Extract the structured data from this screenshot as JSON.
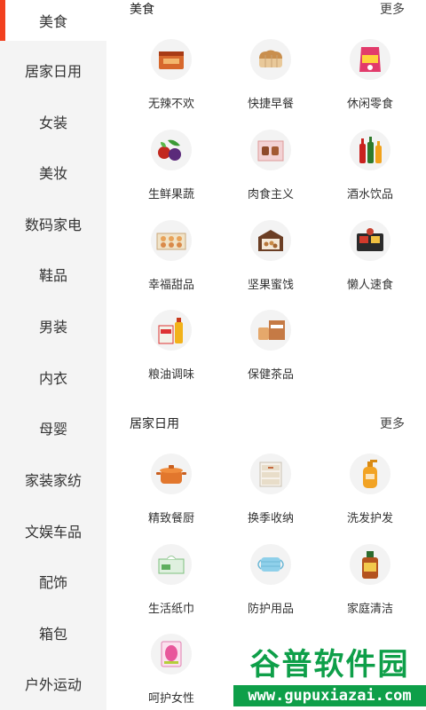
{
  "sidebar": {
    "items": [
      {
        "label": "美食",
        "active": true
      },
      {
        "label": "居家日用"
      },
      {
        "label": "女装"
      },
      {
        "label": "美妆"
      },
      {
        "label": "数码家电"
      },
      {
        "label": "鞋品"
      },
      {
        "label": "男装"
      },
      {
        "label": "内衣"
      },
      {
        "label": "母婴"
      },
      {
        "label": "家装家纺"
      },
      {
        "label": "文娱车品"
      },
      {
        "label": "配饰"
      },
      {
        "label": "箱包"
      },
      {
        "label": "户外运动"
      }
    ]
  },
  "sections": [
    {
      "title": "美食",
      "more": "更多",
      "items": [
        {
          "label": "无辣不欢",
          "icon": "spicy-snack-icon"
        },
        {
          "label": "快捷早餐",
          "icon": "bread-icon"
        },
        {
          "label": "休闲零食",
          "icon": "chips-bag-icon"
        },
        {
          "label": "生鲜果蔬",
          "icon": "fruit-vegetable-icon"
        },
        {
          "label": "肉食主义",
          "icon": "meat-box-icon"
        },
        {
          "label": "酒水饮品",
          "icon": "drink-bottles-icon"
        },
        {
          "label": "幸福甜品",
          "icon": "dessert-box-icon"
        },
        {
          "label": "坚果蜜饯",
          "icon": "nuts-box-icon"
        },
        {
          "label": "懒人速食",
          "icon": "instant-food-icon"
        },
        {
          "label": "粮油调味",
          "icon": "oil-rice-icon"
        },
        {
          "label": "保健茶品",
          "icon": "tea-icon"
        }
      ]
    },
    {
      "title": "居家日用",
      "more": "更多",
      "items": [
        {
          "label": "精致餐厨",
          "icon": "pot-icon"
        },
        {
          "label": "换季收纳",
          "icon": "storage-drawer-icon"
        },
        {
          "label": "洗发护发",
          "icon": "shampoo-bottle-icon"
        },
        {
          "label": "生活纸巾",
          "icon": "tissue-icon"
        },
        {
          "label": "防护用品",
          "icon": "face-mask-icon"
        },
        {
          "label": "家庭清洁",
          "icon": "cleaner-bottle-icon"
        },
        {
          "label": "呵护女性",
          "icon": "pad-pack-icon"
        }
      ]
    }
  ],
  "watermark": {
    "main": "谷普软件园",
    "url": "www.gupuxiazai.com"
  },
  "colors": {
    "accent": "#f2401e",
    "sidebar_bg": "#f4f4f4",
    "watermark": "#0e9f49"
  }
}
